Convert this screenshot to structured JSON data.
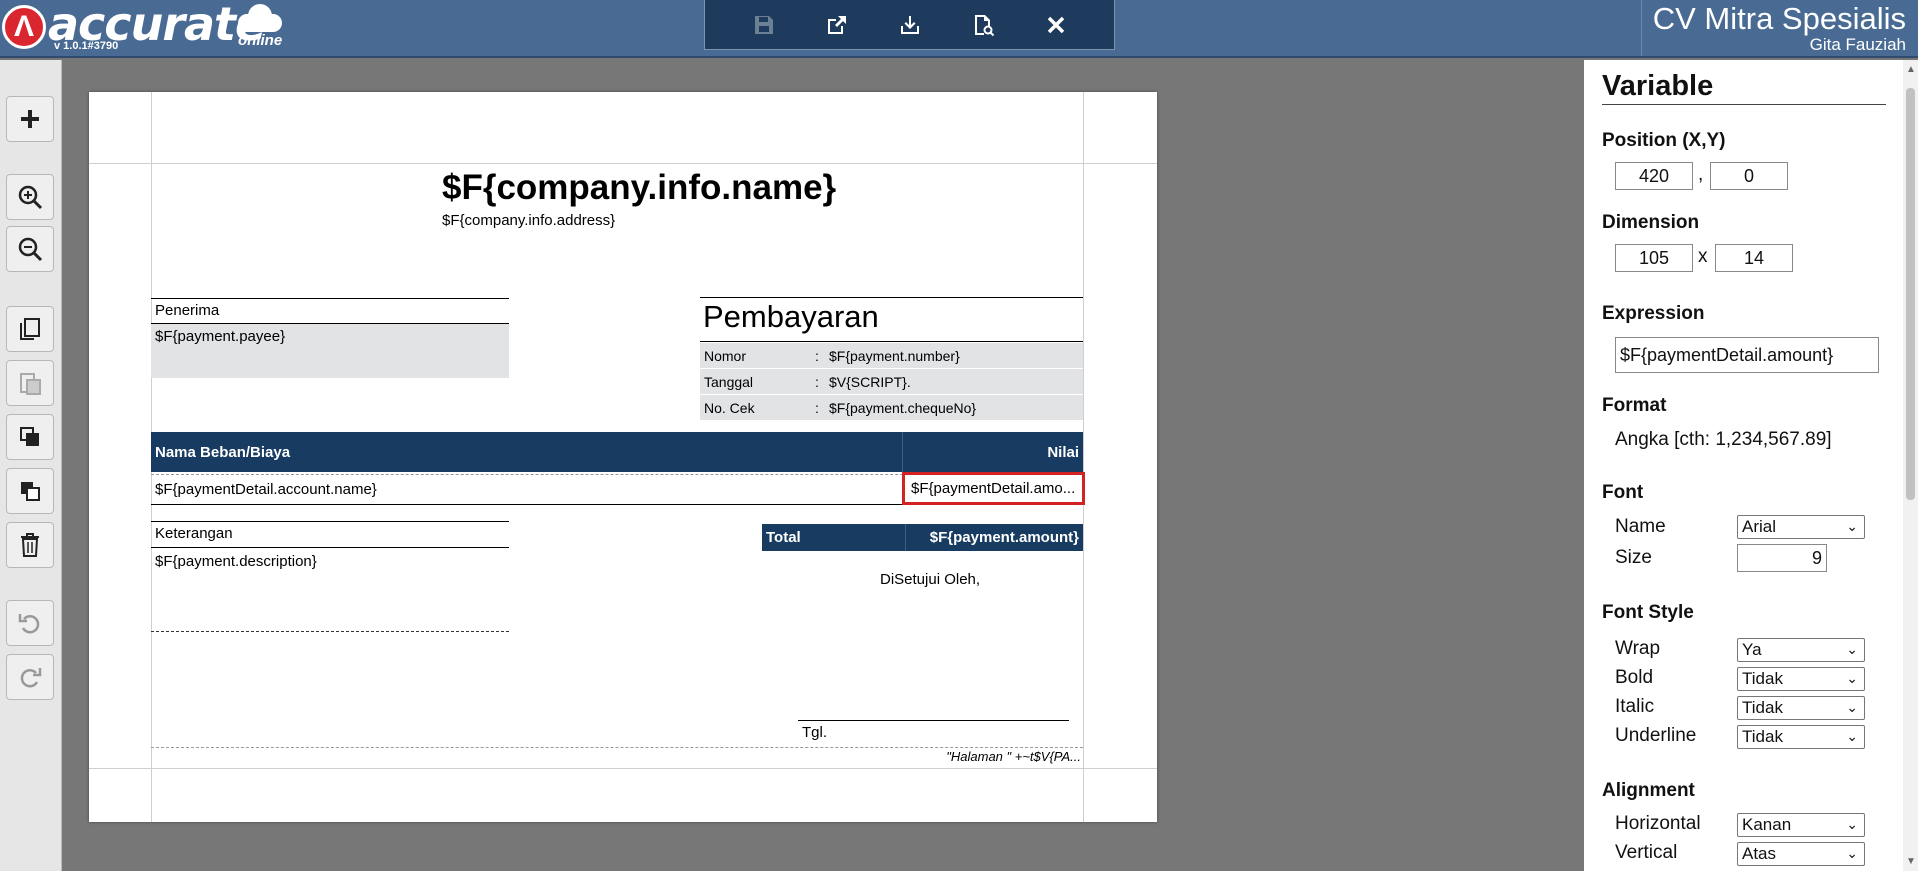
{
  "app": {
    "logo_text": "accurate",
    "logo_sub": "online",
    "version": "v 1.0.1#3790"
  },
  "header": {
    "company": "CV Mitra Spesialis",
    "user": "Gita Fauziah"
  },
  "toolbar": {
    "icons": [
      "save-icon",
      "export-icon",
      "import-icon",
      "preview-icon",
      "close-icon"
    ]
  },
  "left_tools": {
    "icons": [
      "plus-icon",
      "zoom-in-icon",
      "zoom-out-icon",
      "copy-icon",
      "paste-icon",
      "bring-to-front-icon",
      "send-to-back-icon",
      "trash-icon",
      "undo-icon",
      "redo-icon"
    ]
  },
  "report": {
    "company_name": "$F{company.info.name}",
    "company_address": "$F{company.info.address}",
    "payee_label": "Penerima",
    "payee_value": "$F{payment.payee}",
    "title": "Pembayaran",
    "info_rows": [
      {
        "label": "Nomor",
        "sep": ":",
        "value": "$F{payment.number}"
      },
      {
        "label": "Tanggal",
        "sep": ":",
        "value": "$V{SCRIPT}."
      },
      {
        "label": "No. Cek",
        "sep": ":",
        "value": "$F{payment.chequeNo}"
      }
    ],
    "col_name": "Nama Beban/Biaya",
    "col_value": "Nilai",
    "detail_name": "$F{paymentDetail.account.name}",
    "detail_amount": "$F{paymentDetail.amo...",
    "notes_label": "Keterangan",
    "notes_value": "$F{payment.description}",
    "total_label": "Total",
    "total_value": "$F{payment.amount}",
    "approved": "DiSetujui Oleh,",
    "date_label": "Tgl.",
    "page_footer": "\"Halaman \" +~t$V{PA..."
  },
  "props": {
    "title": "Variable",
    "position_label": "Position (X,Y)",
    "pos_x": "420",
    "pos_sep": ",",
    "pos_y": "0",
    "dimension_label": "Dimension",
    "dim_w": "105",
    "dim_sep": "x",
    "dim_h": "14",
    "expression_label": "Expression",
    "expression": "$F{paymentDetail.amount}",
    "format_label": "Format",
    "format_value": "Angka [cth: 1,234,567.89]",
    "font_label": "Font",
    "font_name_label": "Name",
    "font_name": "Arial",
    "font_size_label": "Size",
    "font_size": "9",
    "font_style_label": "Font Style",
    "wrap_label": "Wrap",
    "wrap": "Ya",
    "bold_label": "Bold",
    "bold": "Tidak",
    "italic_label": "Italic",
    "italic": "Tidak",
    "underline_label": "Underline",
    "underline": "Tidak",
    "alignment_label": "Alignment",
    "horizontal_label": "Horizontal",
    "horizontal": "Kanan",
    "vertical_label": "Vertical",
    "vertical": "Atas"
  }
}
